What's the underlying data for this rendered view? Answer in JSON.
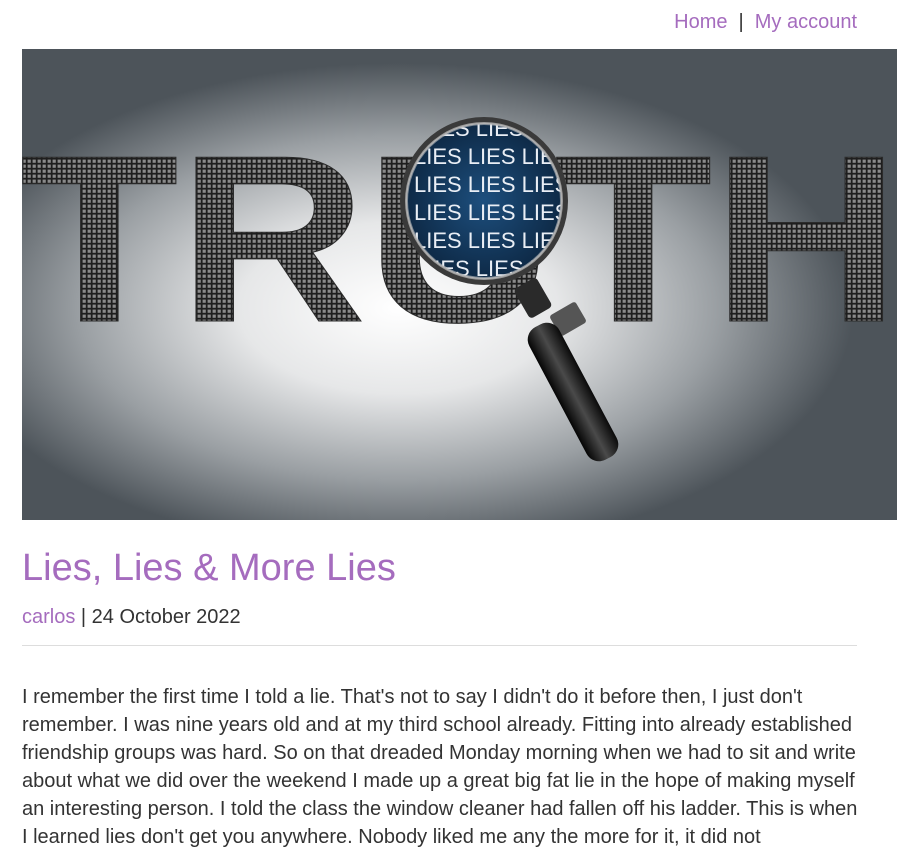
{
  "nav": {
    "home_label": "Home",
    "separator": "|",
    "account_label": "My account"
  },
  "hero": {
    "big_word": "TRUTH",
    "lens_word": "LIES LIES LIES LIES"
  },
  "post": {
    "title": "Lies, Lies & More Lies",
    "author": "carlos",
    "meta_separator": " | ",
    "date": "24 October 2022",
    "body": "I remember the first time I told a lie. That's not to say I didn't do it before then, I just don't remember. I was nine years old and at my third school already. Fitting into already established friendship groups was hard. So on that dreaded Monday morning when we had to sit and write about what we did over the weekend I made up a great big fat lie in the hope of making myself an interesting person. I told the class the window cleaner had fallen off his ladder. This is when I learned lies don't get you anywhere. Nobody liked me any the more for it, it did not"
  },
  "colors": {
    "link": "#a56cbe",
    "text": "#333333",
    "divider": "#dddddd"
  }
}
